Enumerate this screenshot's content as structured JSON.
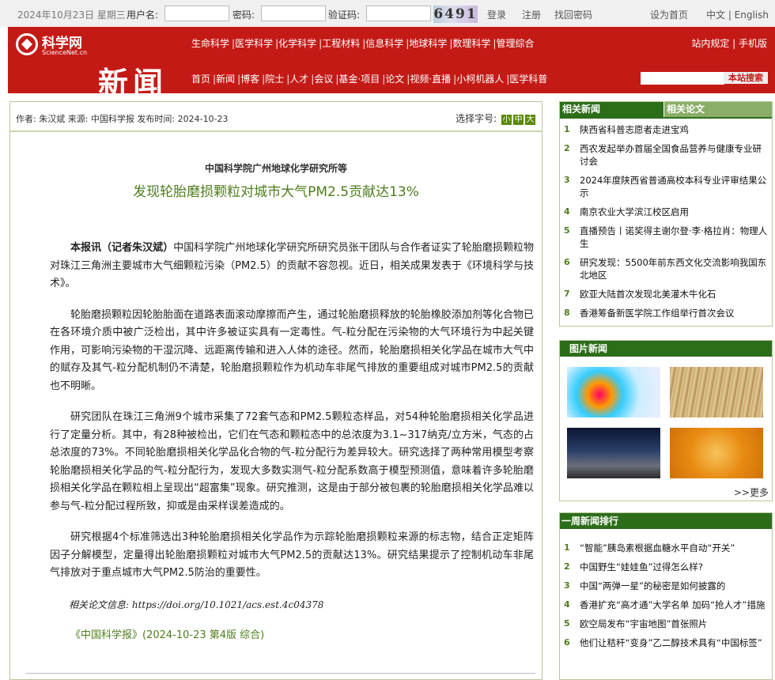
{
  "topbar": {
    "date": "2024年10月23日 星期三",
    "username_label": "用户名:",
    "password_label": "密码:",
    "captcha_label": "验证码:",
    "captcha_text": "6491",
    "login": "登录",
    "register": "注册",
    "forgot": "找回密码",
    "set_home": "设为首页",
    "lang": "中文 | English"
  },
  "header": {
    "logo_name": "科学网",
    "logo_en": "ScienceNet.cn",
    "section": "新闻",
    "nav1": [
      "生命科学",
      "医学科学",
      "化学科学",
      "工程材料",
      "信息科学",
      "地球科学",
      "数理科学",
      "管理综合"
    ],
    "nav2": [
      "首页",
      "新闻",
      "博客",
      "院士",
      "人才",
      "会议",
      "基金·项目",
      "论文",
      "视频·直播",
      "小柯机器人",
      "医学科普"
    ],
    "right_links": "站内规定 | 手机版",
    "search_button": "本站搜索"
  },
  "article": {
    "meta": "作者: 朱汉斌  来源:  中国科学报  发布时间: 2024-10-23",
    "font_select_label": "选择字号:",
    "font_sizes": [
      "小",
      "中",
      "大"
    ],
    "org": "中国科学院广州地球化学研究所等",
    "title": "发现轮胎磨损颗粒对城市大气PM2.5贡献达13%",
    "lead_bold": "本报讯（记者朱汉斌）",
    "p1": "中国科学院广州地球化学研究所研究员张干团队与合作者证实了轮胎磨损颗粒物对珠江三角洲主要城市大气细颗粒污染（PM2.5）的贡献不容忽视。近日，相关成果发表于《环境科学与技术》。",
    "p2": "轮胎磨损颗粒因轮胎胎面在道路表面滚动摩擦而产生，通过轮胎磨损释放的轮胎橡胶添加剂等化合物已在各环境介质中被广泛检出，其中许多被证实具有一定毒性。气-粒分配在污染物的大气环境行为中起关键作用，可影响污染物的干湿沉降、远距离传输和进入人体的途径。然而，轮胎磨损相关化学品在城市大气中的赋存及其气-粒分配机制仍不清楚，轮胎磨损颗粒作为机动车非尾气排放的重要组成对城市PM2.5的贡献也不明晰。",
    "p3": "研究团队在珠江三角洲9个城市采集了72套气态和PM2.5颗粒态样品，对54种轮胎磨损相关化学品进行了定量分析。其中，有28种被检出，它们在气态和颗粒态中的总浓度为3.1~317纳克/立方米，气态的占总浓度的73%。不同轮胎磨损相关化学品化合物的气-粒分配行为差异较大。研究选择了两种常用模型考察轮胎磨损相关化学品的气-粒分配行为，发现大多数实测气-粒分配系数高于模型预测值，意味着许多轮胎磨损相关化学品在颗粒相上呈现出“超富集”现象。研究推测，这是由于部分被包裹的轮胎磨损相关化学品难以参与气-粒分配过程所致，抑或是由采样误差造成的。",
    "p4": "研究根据4个标准筛选出3种轮胎磨损相关化学品作为示踪轮胎磨损颗粒来源的标志物，结合正定矩阵因子分解模型，定量得出轮胎磨损颗粒对城市大气PM2.5的贡献达13%。研究结果提示了控制机动车非尾气排放对于重点城市大气PM2.5防治的重要性。",
    "cite": "相关论文信息: https://doi.org/10.1021/acs.est.4c04378",
    "source_link": "《中国科学报》",
    "source_rest": "(2024-10-23 第4版 综合)"
  },
  "related": {
    "tab_news": "相关新闻",
    "tab_papers": "相关论文",
    "items": [
      "陕西省科普志愿者走进宝鸡",
      "西农发起举办首届全国食品营养与健康专业研讨会",
      "2024年度陕西省普通高校本科专业评审结果公示",
      "南京农业大学滨江校区启用",
      "直播预告丨诺奖得主谢尔登·李·格拉肖：物理人生",
      "研究发现：5500年前东西文化交流影响我国东北地区",
      "欧亚大陆首次发现北美灌木牛化石",
      "香港筹备新医学院工作组举行首次会议"
    ]
  },
  "pictures": {
    "title": "图片新闻",
    "more": ">>更多"
  },
  "weekly": {
    "title": "一周新闻排行",
    "items": [
      "“智能”胰岛素根据血糖水平自动“开关”",
      "中国野生“娃娃鱼”过得怎么样?",
      "中国“两弹一星”的秘密是如何披露的",
      "香港扩充“高才通”大学名单 加码“抢人才”措施",
      "欧空局发布“宇宙地图”首张照片",
      "他们让秸秆“变身”乙二醇技术具有“中国标签”"
    ]
  }
}
